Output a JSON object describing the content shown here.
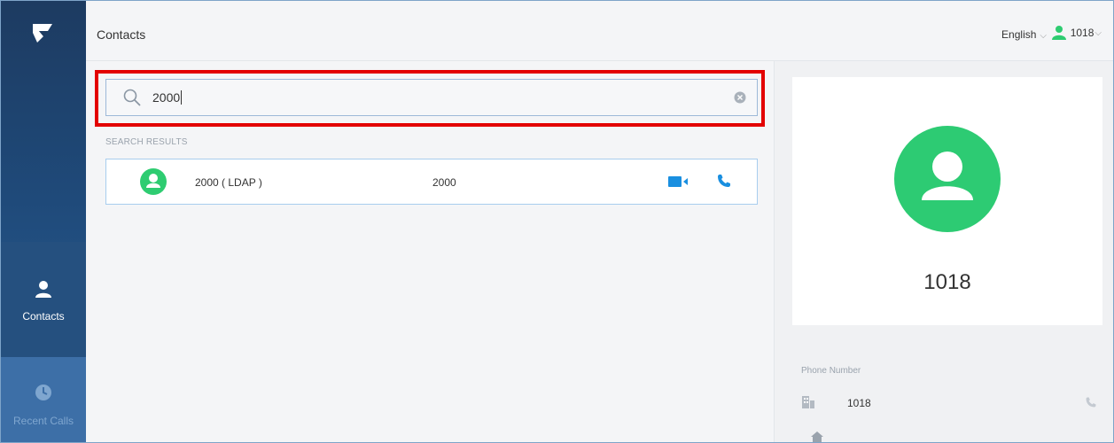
{
  "app": {
    "title": "Contacts"
  },
  "sidebar": {
    "logo_icon": "grandstream-logo-icon",
    "items": [
      {
        "label": "Contacts",
        "icon": "person-icon",
        "active": true
      },
      {
        "label": "Recent Calls",
        "icon": "clock-icon",
        "active": false
      }
    ]
  },
  "header": {
    "title": "Contacts",
    "language": "English",
    "user": "1018"
  },
  "search": {
    "value": "2000",
    "section_label": "SEARCH RESULTS"
  },
  "results": [
    {
      "name": "2000 ( LDAP )",
      "number": "2000"
    }
  ],
  "details": {
    "name": "1018",
    "phone_label": "Phone Number",
    "phone_value": "1018"
  },
  "colors": {
    "sidebar": "#1f4a7a",
    "accent_green": "#2ecc71",
    "accent_blue": "#1a8fe0",
    "highlight_red": "#e30000"
  }
}
